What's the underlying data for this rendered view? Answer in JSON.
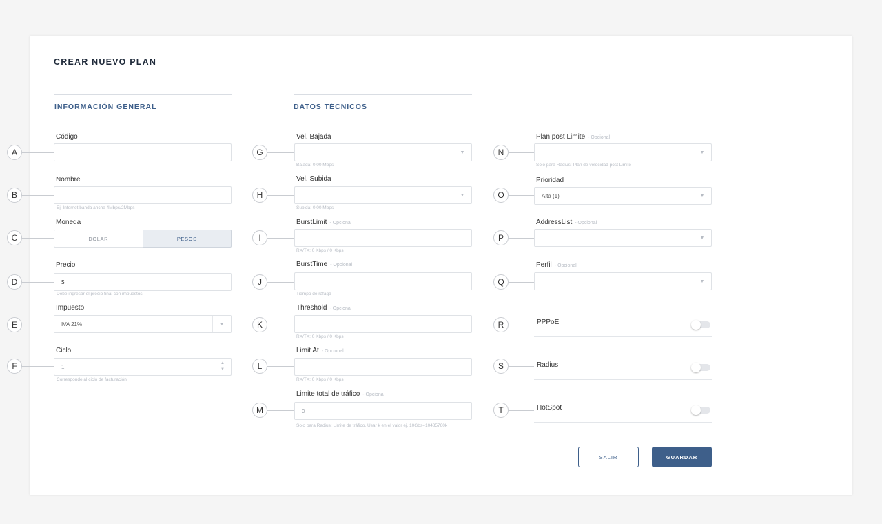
{
  "page": {
    "title": "CREAR NUEVO PLAN"
  },
  "sections": {
    "general": "INFORMACIÓN GENERAL",
    "technical": "DATOS TÉCNICOS"
  },
  "markers": [
    "A",
    "B",
    "C",
    "D",
    "E",
    "F",
    "G",
    "H",
    "I",
    "J",
    "K",
    "L",
    "M",
    "N",
    "O",
    "P",
    "Q",
    "R",
    "S",
    "T"
  ],
  "general": {
    "codigo": {
      "label": "Código",
      "value": ""
    },
    "nombre": {
      "label": "Nombre",
      "value": "",
      "hint": "Ej: Internet banda ancha 4Mbps/2Mbps"
    },
    "moneda": {
      "label": "Moneda",
      "options": [
        "DOLAR",
        "PESOS"
      ],
      "selected": "PESOS"
    },
    "precio": {
      "label": "Precio",
      "value": "$",
      "hint": "Debe ingresar el precio final con impuestos"
    },
    "impuesto": {
      "label": "Impuesto",
      "value": "IVA 21%"
    },
    "ciclo": {
      "label": "Ciclo",
      "value": "1",
      "hint": "Corresponde al ciclo de facturación"
    }
  },
  "technical": {
    "vel_bajada": {
      "label": "Vel. Bajada",
      "value": "",
      "hint": "Bajada: 0.00 Mbps"
    },
    "vel_subida": {
      "label": "Vel. Subida",
      "value": "",
      "hint": "Subida: 0.00 Mbps"
    },
    "burst_limit": {
      "label": "BurstLimit",
      "optional": "- Opcional",
      "value": "",
      "hint": "RX/TX: 0 Kbps / 0 Kbps"
    },
    "burst_time": {
      "label": "BurstTime",
      "optional": "- Opcional",
      "value": "",
      "hint": "Tiempo de ráfaga"
    },
    "threshold": {
      "label": "Threshold",
      "optional": "- Opcional",
      "value": "",
      "hint": "RX/TX: 0 Kbps / 0 Kbps"
    },
    "limit_at": {
      "label": "Limit At",
      "optional": "- Opcional",
      "value": "",
      "hint": "RX/TX: 0 Kbps / 0 Kbps"
    },
    "limite_total": {
      "label": "Limite total de tráfico",
      "optional": "- Opcional",
      "value": "0",
      "hint": "Solo para Radius: Limite de tráfico. Usar k en el valor ej. 10Gbs=10485760k"
    }
  },
  "extra": {
    "plan_post": {
      "label": "Plan post Limite",
      "optional": "- Opcional",
      "value": "",
      "hint": "Solo para Radius: Plan de velocidad post Limite"
    },
    "prioridad": {
      "label": "Prioridad",
      "value": "Alta (1)"
    },
    "address_list": {
      "label": "AddressList",
      "optional": "- Opcional",
      "value": ""
    },
    "perfil": {
      "label": "Perfil",
      "optional": "- Opcional",
      "value": ""
    },
    "pppoe": {
      "label": "PPPoE",
      "enabled": false
    },
    "radius": {
      "label": "Radius",
      "enabled": false
    },
    "hotspot": {
      "label": "HotSpot",
      "enabled": false
    }
  },
  "actions": {
    "exit": "SALIR",
    "save": "GUARDAR"
  },
  "colors": {
    "accent": "#3e5f8a",
    "background": "#f5f5f5",
    "card": "#ffffff"
  }
}
